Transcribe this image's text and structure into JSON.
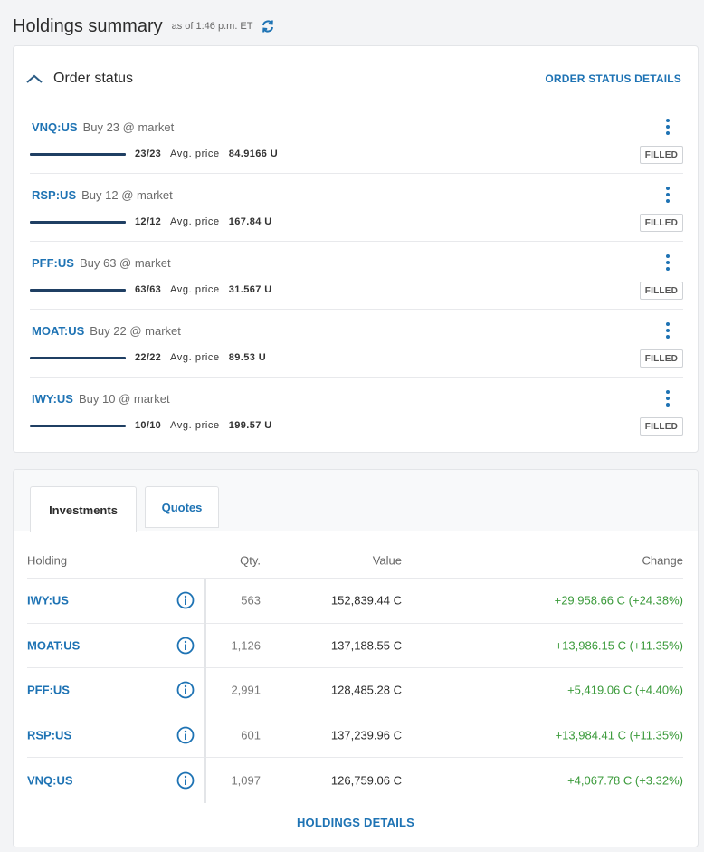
{
  "header": {
    "title": "Holdings summary",
    "as_of": "as of 1:46 p.m. ET"
  },
  "order_status": {
    "toggle_label": "Order status",
    "details_link": "ORDER STATUS DETAILS",
    "avg_label": "Avg. price",
    "orders": [
      {
        "symbol": "VNQ:US",
        "description": "Buy 23 @ market",
        "filled": "23/23",
        "fill_fraction": 1.0,
        "avg_price": "84.9166 U",
        "status": "FILLED"
      },
      {
        "symbol": "RSP:US",
        "description": "Buy 12 @ market",
        "filled": "12/12",
        "fill_fraction": 1.0,
        "avg_price": "167.84 U",
        "status": "FILLED"
      },
      {
        "symbol": "PFF:US",
        "description": "Buy 63 @ market",
        "filled": "63/63",
        "fill_fraction": 1.0,
        "avg_price": "31.567 U",
        "status": "FILLED"
      },
      {
        "symbol": "MOAT:US",
        "description": "Buy 22 @ market",
        "filled": "22/22",
        "fill_fraction": 1.0,
        "avg_price": "89.53 U",
        "status": "FILLED"
      },
      {
        "symbol": "IWY:US",
        "description": "Buy 10 @ market",
        "filled": "10/10",
        "fill_fraction": 1.0,
        "avg_price": "199.57 U",
        "status": "FILLED"
      }
    ]
  },
  "tabs": {
    "investments": "Investments",
    "quotes": "Quotes",
    "active": "Investments"
  },
  "holdings": {
    "columns": {
      "holding": "Holding",
      "qty": "Qty.",
      "value": "Value",
      "change": "Change"
    },
    "rows": [
      {
        "symbol": "IWY:US",
        "qty": "563",
        "value": "152,839.44 C",
        "change": "+29,958.66 C (+24.38%)"
      },
      {
        "symbol": "MOAT:US",
        "qty": "1,126",
        "value": "137,188.55 C",
        "change": "+13,986.15 C (+11.35%)"
      },
      {
        "symbol": "PFF:US",
        "qty": "2,991",
        "value": "128,485.28 C",
        "change": "+5,419.06 C (+4.40%)"
      },
      {
        "symbol": "RSP:US",
        "qty": "601",
        "value": "137,239.96 C",
        "change": "+13,984.41 C (+11.35%)"
      },
      {
        "symbol": "VNQ:US",
        "qty": "1,097",
        "value": "126,759.06 C",
        "change": "+4,067.78 C (+3.32%)"
      }
    ],
    "details_link": "HOLDINGS DETAILS"
  },
  "colors": {
    "link": "#1e73b4",
    "positive": "#3a9a3a",
    "progress": "#1f3f63"
  }
}
